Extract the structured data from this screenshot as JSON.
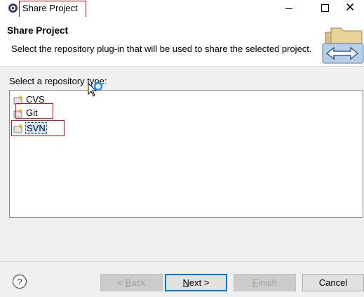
{
  "window": {
    "title": "Share Project"
  },
  "header": {
    "title": "Share Project",
    "description": "Select the repository plug-in that will be used to share the selected project."
  },
  "repository": {
    "label": "Select a repository type:",
    "items": [
      {
        "label": "CVS",
        "selected": false
      },
      {
        "label": "Git",
        "selected": false
      },
      {
        "label": "SVN",
        "selected": true
      }
    ]
  },
  "buttons": {
    "back": {
      "mnemonic": "B",
      "rest": "ack",
      "prefix": "< ",
      "enabled": false
    },
    "next": {
      "mnemonic": "N",
      "rest": "ext >",
      "enabled": true
    },
    "finish": {
      "mnemonic": "F",
      "rest": "inish",
      "enabled": false
    },
    "cancel": {
      "label": "Cancel",
      "enabled": true
    }
  },
  "icons": {
    "app": "eclipse-gear-icon",
    "wizard": "share-folders-arrows-icon",
    "item": "repository-plugin-icon",
    "help": "help-question-icon",
    "cursor": "busy-arrow-cursor"
  },
  "colors": {
    "selection": "#cce8ff",
    "focus": "#0078d7",
    "highlight": "#d01010"
  }
}
